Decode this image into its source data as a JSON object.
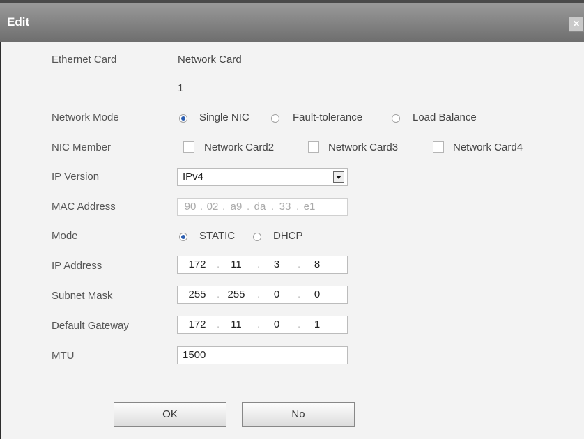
{
  "dialog": {
    "title": "Edit",
    "close_glyph": "×",
    "close_icon": "close-icon"
  },
  "form": {
    "ethernet_card": {
      "label": "Ethernet Card",
      "value": "Network Card",
      "number": "1"
    },
    "network_mode": {
      "label": "Network Mode",
      "options": [
        "Single NIC",
        "Fault-tolerance",
        "Load Balance"
      ],
      "selected": "Single NIC"
    },
    "nic_member": {
      "label": "NIC Member",
      "options": [
        "Network Card2",
        "Network Card3",
        "Network Card4"
      ]
    },
    "ip_version": {
      "label": "IP Version",
      "value": "IPv4"
    },
    "mac_address": {
      "label": "MAC Address",
      "parts": [
        "90",
        "02",
        "a9",
        "da",
        "33",
        "e1"
      ]
    },
    "mode": {
      "label": "Mode",
      "options": [
        "STATIC",
        "DHCP"
      ],
      "selected": "STATIC"
    },
    "ip_address": {
      "label": "IP Address",
      "octets": [
        "172",
        "11",
        "3",
        "8"
      ]
    },
    "subnet_mask": {
      "label": "Subnet Mask",
      "octets": [
        "255",
        "255",
        "0",
        "0"
      ]
    },
    "default_gateway": {
      "label": "Default Gateway",
      "octets": [
        "172",
        "11",
        "0",
        "1"
      ]
    },
    "mtu": {
      "label": "MTU",
      "value": "1500"
    }
  },
  "buttons": {
    "ok": "OK",
    "no": "No"
  }
}
